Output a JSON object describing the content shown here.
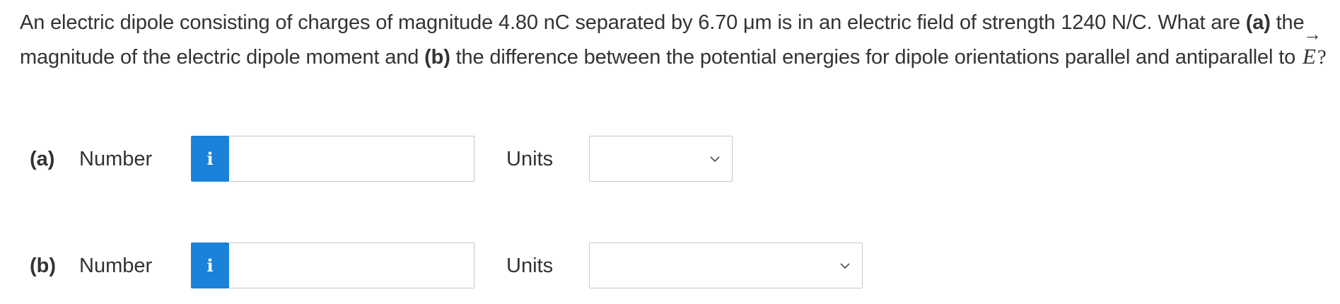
{
  "question": {
    "text_part1": "An electric dipole consisting of charges of magnitude 4.80 nC separated by 6.70 μm is in an electric field of strength 1240 N/C. What are ",
    "part_a_marker": "(a)",
    "text_part2": " the magnitude of the electric dipole moment and ",
    "part_b_marker": "(b)",
    "text_part3": " the difference between the potential energies for dipole orientations parallel and antiparallel to ",
    "vector_symbol": "E",
    "vector_arrow": "→",
    "text_part4": "?"
  },
  "answers": [
    {
      "part_label": "(a)",
      "number_label": "Number",
      "info_label": "i",
      "number_value": "",
      "units_label": "Units",
      "units_selected": ""
    },
    {
      "part_label": "(b)",
      "number_label": "Number",
      "info_label": "i",
      "number_value": "",
      "units_label": "Units",
      "units_selected": ""
    }
  ],
  "colors": {
    "info_button": "#1a82d8",
    "text": "#333333",
    "border": "#c8c8c8"
  },
  "icons": {
    "info": "info-icon",
    "dropdown": "chevron-down-icon"
  }
}
